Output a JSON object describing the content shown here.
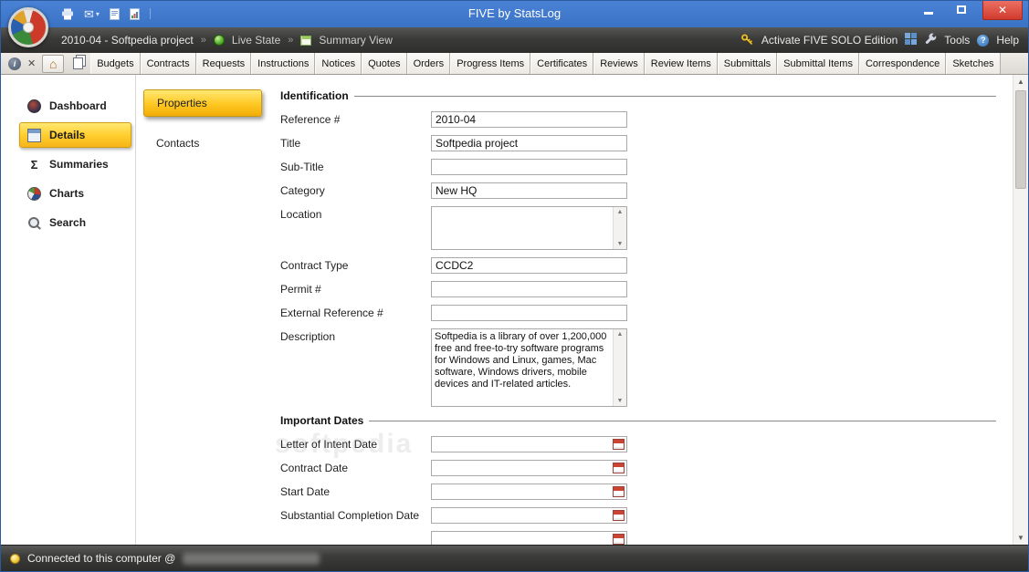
{
  "icons": {
    "close": "✕",
    "dropdown": "▾",
    "breadcrumb_sep": "»",
    "scroll_up": "▲",
    "scroll_down": "▼",
    "home": "⌂",
    "info": "i",
    "help_q": "?",
    "mail": "✉"
  },
  "titlebar": {
    "title": "FIVE by StatsLog"
  },
  "breadcrumb": {
    "project": "2010-04 - Softpedia project",
    "live_state": "Live State",
    "summary_view": "Summary View",
    "activate": "Activate FIVE SOLO Edition",
    "tools": "Tools",
    "help": "Help"
  },
  "tabs": [
    "Budgets",
    "Contracts",
    "Requests",
    "Instructions",
    "Notices",
    "Quotes",
    "Orders",
    "Progress Items",
    "Certificates",
    "Reviews",
    "Review Items",
    "Submittals",
    "Submittal Items",
    "Correspondence",
    "Sketches"
  ],
  "sidebar": [
    {
      "label": "Dashboard",
      "icon": "dashboard",
      "glyph": ""
    },
    {
      "label": "Details",
      "icon": "details",
      "glyph": "",
      "selected": true
    },
    {
      "label": "Summaries",
      "icon": "sigma",
      "glyph": "Σ"
    },
    {
      "label": "Charts",
      "icon": "charts",
      "glyph": ""
    },
    {
      "label": "Search",
      "icon": "search",
      "glyph": ""
    }
  ],
  "subnav": [
    {
      "label": "Properties",
      "selected": true
    },
    {
      "label": "Contacts"
    }
  ],
  "form": {
    "identification": {
      "title": "Identification",
      "fields": [
        {
          "label": "Reference #",
          "value": "2010-04",
          "type": "text"
        },
        {
          "label": "Title",
          "value": "Softpedia project",
          "type": "text"
        },
        {
          "label": "Sub-Title",
          "value": "",
          "type": "text"
        },
        {
          "label": "Category",
          "value": "New HQ",
          "type": "text"
        },
        {
          "label": "Location",
          "value": "",
          "type": "textarea",
          "h": 48
        },
        {
          "label": "Contract Type",
          "value": "CCDC2",
          "type": "text"
        },
        {
          "label": "Permit #",
          "value": "",
          "type": "text"
        },
        {
          "label": "External Reference #",
          "value": "",
          "type": "text"
        },
        {
          "label": "Description",
          "value": "Softpedia is a library of over 1,200,000 free and free-to-try software programs for Windows and Linux, games, Mac software, Windows drivers, mobile devices and IT-related articles.",
          "type": "textarea",
          "h": 86
        }
      ]
    },
    "important_dates": {
      "title": "Important Dates",
      "fields": [
        {
          "label": "Letter of Intent Date",
          "value": "",
          "type": "date"
        },
        {
          "label": "Contract Date",
          "value": "",
          "type": "date"
        },
        {
          "label": "Start Date",
          "value": "",
          "type": "date"
        },
        {
          "label": "Substantial Completion Date",
          "value": "",
          "type": "date"
        },
        {
          "label": "",
          "value": "",
          "type": "date"
        }
      ]
    }
  },
  "watermark": "softpedia",
  "statusbar": {
    "text": "Connected to this computer @"
  }
}
